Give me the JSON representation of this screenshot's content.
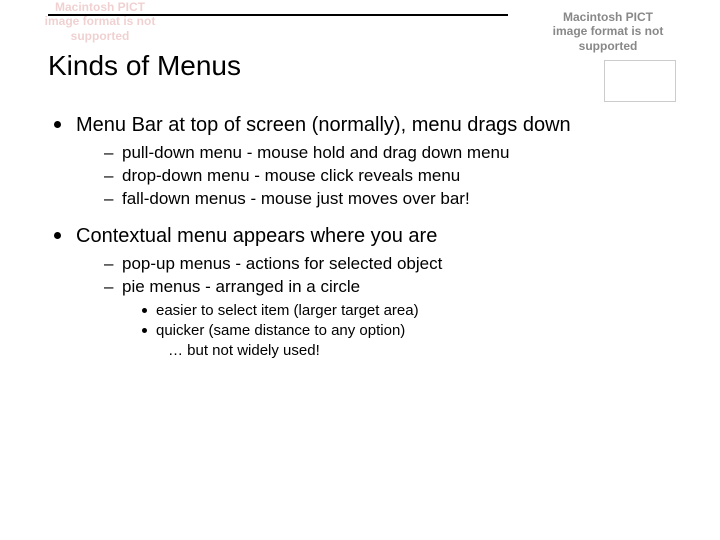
{
  "errors": {
    "pict": "Macintosh PICT image format is not supported",
    "pict2": "Macintosh PICT image format is not supported"
  },
  "title": "Kinds of Menus",
  "bullets": [
    {
      "text": "Menu Bar at top of screen (normally), menu drags down",
      "sub": [
        "pull-down menu - mouse hold and drag down menu",
        "drop-down menu - mouse click reveals menu",
        "fall-down menus - mouse just moves over bar!"
      ]
    },
    {
      "text": "Contextual menu appears where you are",
      "sub": [
        "pop-up menus - actions for selected object",
        "pie menus - arranged in a circle"
      ],
      "subsub": [
        "easier to select item (larger target area)",
        "quicker (same distance to any option)",
        "… but not widely used!"
      ]
    }
  ]
}
